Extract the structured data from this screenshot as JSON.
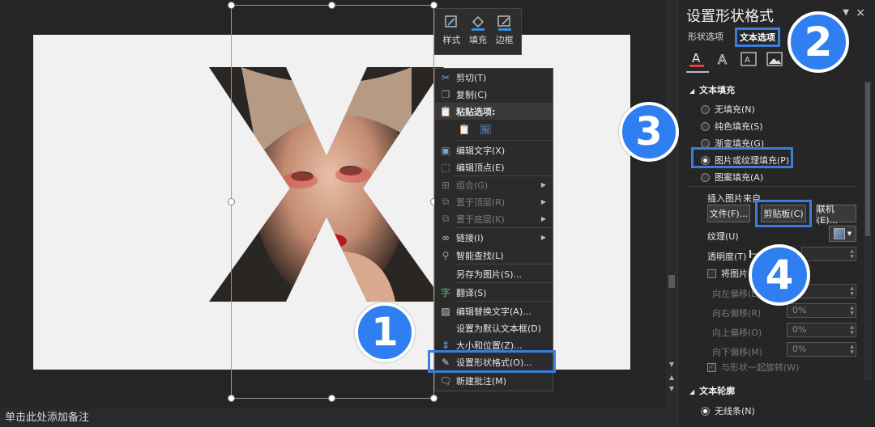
{
  "mini_toolbar": {
    "style_label": "样式",
    "fill_label": "填充",
    "border_label": "边框"
  },
  "context_menu": {
    "items": [
      {
        "label": "剪切(T)",
        "icon": "scissors-icon"
      },
      {
        "label": "复制(C)",
        "icon": "copy-icon"
      },
      {
        "label": "粘贴选项:",
        "icon": "paste-icon"
      },
      {
        "label": "编辑文字(X)",
        "icon": "edit-text-icon"
      },
      {
        "label": "编辑顶点(E)",
        "icon": "edit-points-icon"
      },
      {
        "label": "组合(G)",
        "icon": "group-icon"
      },
      {
        "label": "置于顶层(R)",
        "icon": "bring-front-icon"
      },
      {
        "label": "置于底层(K)",
        "icon": "send-back-icon"
      },
      {
        "label": "链接(I)",
        "icon": "link-icon"
      },
      {
        "label": "智能查找(L)",
        "icon": "smart-lookup-icon"
      },
      {
        "label": "另存为图片(S)...",
        "icon": ""
      },
      {
        "label": "翻译(S)",
        "icon": "translate-icon"
      },
      {
        "label": "编辑替换文字(A)...",
        "icon": "alt-text-icon"
      },
      {
        "label": "设置为默认文本框(D)",
        "icon": ""
      },
      {
        "label": "大小和位置(Z)...",
        "icon": "size-position-icon"
      },
      {
        "label": "设置形状格式(O)...",
        "icon": "format-shape-icon"
      },
      {
        "label": "新建批注(M)",
        "icon": "new-comment-icon"
      }
    ]
  },
  "panel": {
    "title": "设置形状格式",
    "close": "×",
    "tab_shape": "形状选项",
    "tab_text": "文本选项",
    "text_fill_header": "文本填充",
    "fill_options": [
      "无填充(N)",
      "纯色填充(S)",
      "渐变填充(G)",
      "图片或纹理填充(P)",
      "图案填充(A)"
    ],
    "selected_fill": 3,
    "insert_from": "插入图片来自",
    "btn_file": "文件(F)...",
    "btn_clipboard": "剪贴板(C)",
    "btn_online": "联机(E)...",
    "texture_label": "纹理(U)",
    "transparency_label": "透明度(T)",
    "tile_label": "将图片平",
    "offset_left": "向左偏移(L)",
    "offset_right": "向右偏移(R)",
    "offset_right_value": "0%",
    "offset_top": "向上偏移(O)",
    "offset_top_value": "0%",
    "offset_bottom": "向下偏移(M)",
    "offset_bottom_value": "0%",
    "rotate_with_shape": "与形状一起旋转(W)",
    "text_outline_header": "文本轮廓",
    "no_line": "无线条(N)"
  },
  "status_bar": {
    "notes_hint": "单击此处添加备注"
  },
  "badges": [
    "1",
    "2",
    "3",
    "4"
  ],
  "colors": {
    "accent": "#3b7ddd",
    "badge": "#2f7ff0"
  }
}
